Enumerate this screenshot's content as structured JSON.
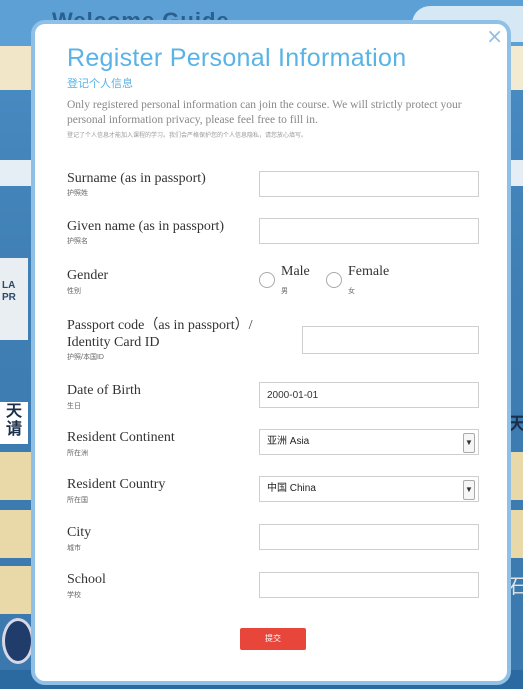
{
  "background": {
    "site_title": "Welcome Guide",
    "badge_text": "LA PR",
    "left_char": "天 请",
    "right_char": "天",
    "right_char2": "石"
  },
  "modal": {
    "title": "Register Personal Information",
    "subtitle": "登记个人信息",
    "intro_en": "Only registered personal information can join the course. We will strictly protect your personal information privacy, please feel free to fill in.",
    "intro_cn": "登记了个人信息才能加入课程的学习。我们会严格保护您的个人信息隐私，请您放心填写。",
    "close_icon": "×"
  },
  "form": {
    "surname": {
      "label": "Surname (as in passport)",
      "label_cn": "护照姓",
      "value": ""
    },
    "given_name": {
      "label": "Given name (as in passport)",
      "label_cn": "护照名",
      "value": ""
    },
    "gender": {
      "label": "Gender",
      "label_cn": "性别",
      "options": [
        {
          "en": "Male",
          "cn": "男"
        },
        {
          "en": "Female",
          "cn": "女"
        }
      ]
    },
    "passport": {
      "label": "Passport code（as in passport）/ Identity Card ID",
      "label_cn": "护照/本国ID",
      "value": ""
    },
    "dob": {
      "label": "Date of Birth",
      "label_cn": "生日",
      "value": "2000-01-01"
    },
    "continent": {
      "label": "Resident Continent",
      "label_cn": "所在洲",
      "value": "亚洲 Asia"
    },
    "country": {
      "label": "Resident Country",
      "label_cn": "所在国",
      "value": "中国 China"
    },
    "city": {
      "label": "City",
      "label_cn": "城市",
      "value": ""
    },
    "school": {
      "label": "School",
      "label_cn": "学校",
      "value": ""
    }
  },
  "submit_label": "提交",
  "icons": {
    "close": "close-icon",
    "select_arrow": "chevron-down-icon",
    "radio": "radio-circle"
  },
  "colors": {
    "accent": "#5ab3e6",
    "submit": "#e8463b",
    "modal_border": "#8fc0e8"
  }
}
